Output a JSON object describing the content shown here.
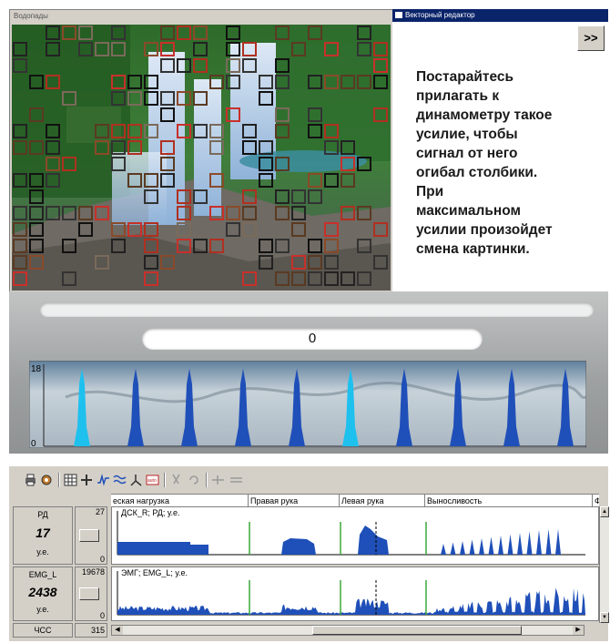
{
  "photo_window": {
    "title": "Водопады"
  },
  "vector_editor": {
    "title": "Векторный редактор",
    "next_button": ">>",
    "instruction": "   Постарайтесь\nприлагать к\nдинамометру такое\nусилие, чтобы\nсигнал от него\nогибал столбики.\n   При\nмаксимальном\nусилии произойдет\nсмена картинки."
  },
  "biofeedback": {
    "counter": "0",
    "y_top_label": "18",
    "y_bottom_label": "0",
    "bar_levels": [
      0.95,
      0.95,
      0.95,
      0.95,
      0.95,
      0.95,
      0.95,
      0.95,
      0.95,
      0.95
    ],
    "colors": {
      "bar_light": "#1ec0ee",
      "bar_dark": "#1f4fb8"
    }
  },
  "recorder": {
    "segments": [
      "еская нагрузка",
      "Правая рука",
      "Левая рука",
      "Выносливость",
      "Ф"
    ],
    "channels": [
      {
        "name": "РД",
        "value": "17",
        "unit": "у.е.",
        "max": "27",
        "min": "0",
        "trace_label": "ДСК_R; РД; у.е."
      },
      {
        "name": "EMG_L",
        "value": "2438",
        "unit": "у.е.",
        "max": "19678",
        "min": "0",
        "trace_label": "ЭМГ; EMG_L; у.е."
      }
    ],
    "hr": {
      "name": "ЧСС",
      "value": "315"
    },
    "colors": {
      "signal": "#1f4fb8",
      "marker": "#3aa83a"
    }
  }
}
